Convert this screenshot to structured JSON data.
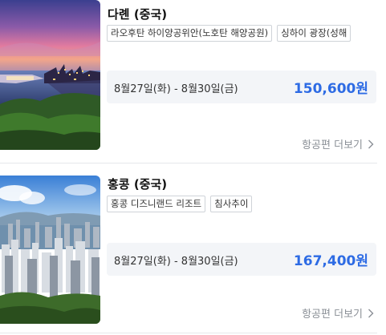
{
  "results": [
    {
      "destination": "다롄 (중국)",
      "tags": [
        "라오후탄 하이양공위안(노호탄 해양공원)",
        "싱하이 광장(성해"
      ],
      "dates": "8월27일(화) - 8월30일(금)",
      "price": "150,600원",
      "more_label": "항공편 더보기"
    },
    {
      "destination": "홍콩 (중국)",
      "tags": [
        "홍콩 디즈니랜드 리조트",
        "침사추이"
      ],
      "dates": "8월27일(화) - 8월30일(금)",
      "price": "167,400원",
      "more_label": "항공편 더보기"
    }
  ],
  "colors": {
    "price": "#2d6be4",
    "muted": "#8a8f96",
    "price_bg": "#f3f5f8"
  },
  "icons": {
    "more": "chevron-right-icon"
  }
}
